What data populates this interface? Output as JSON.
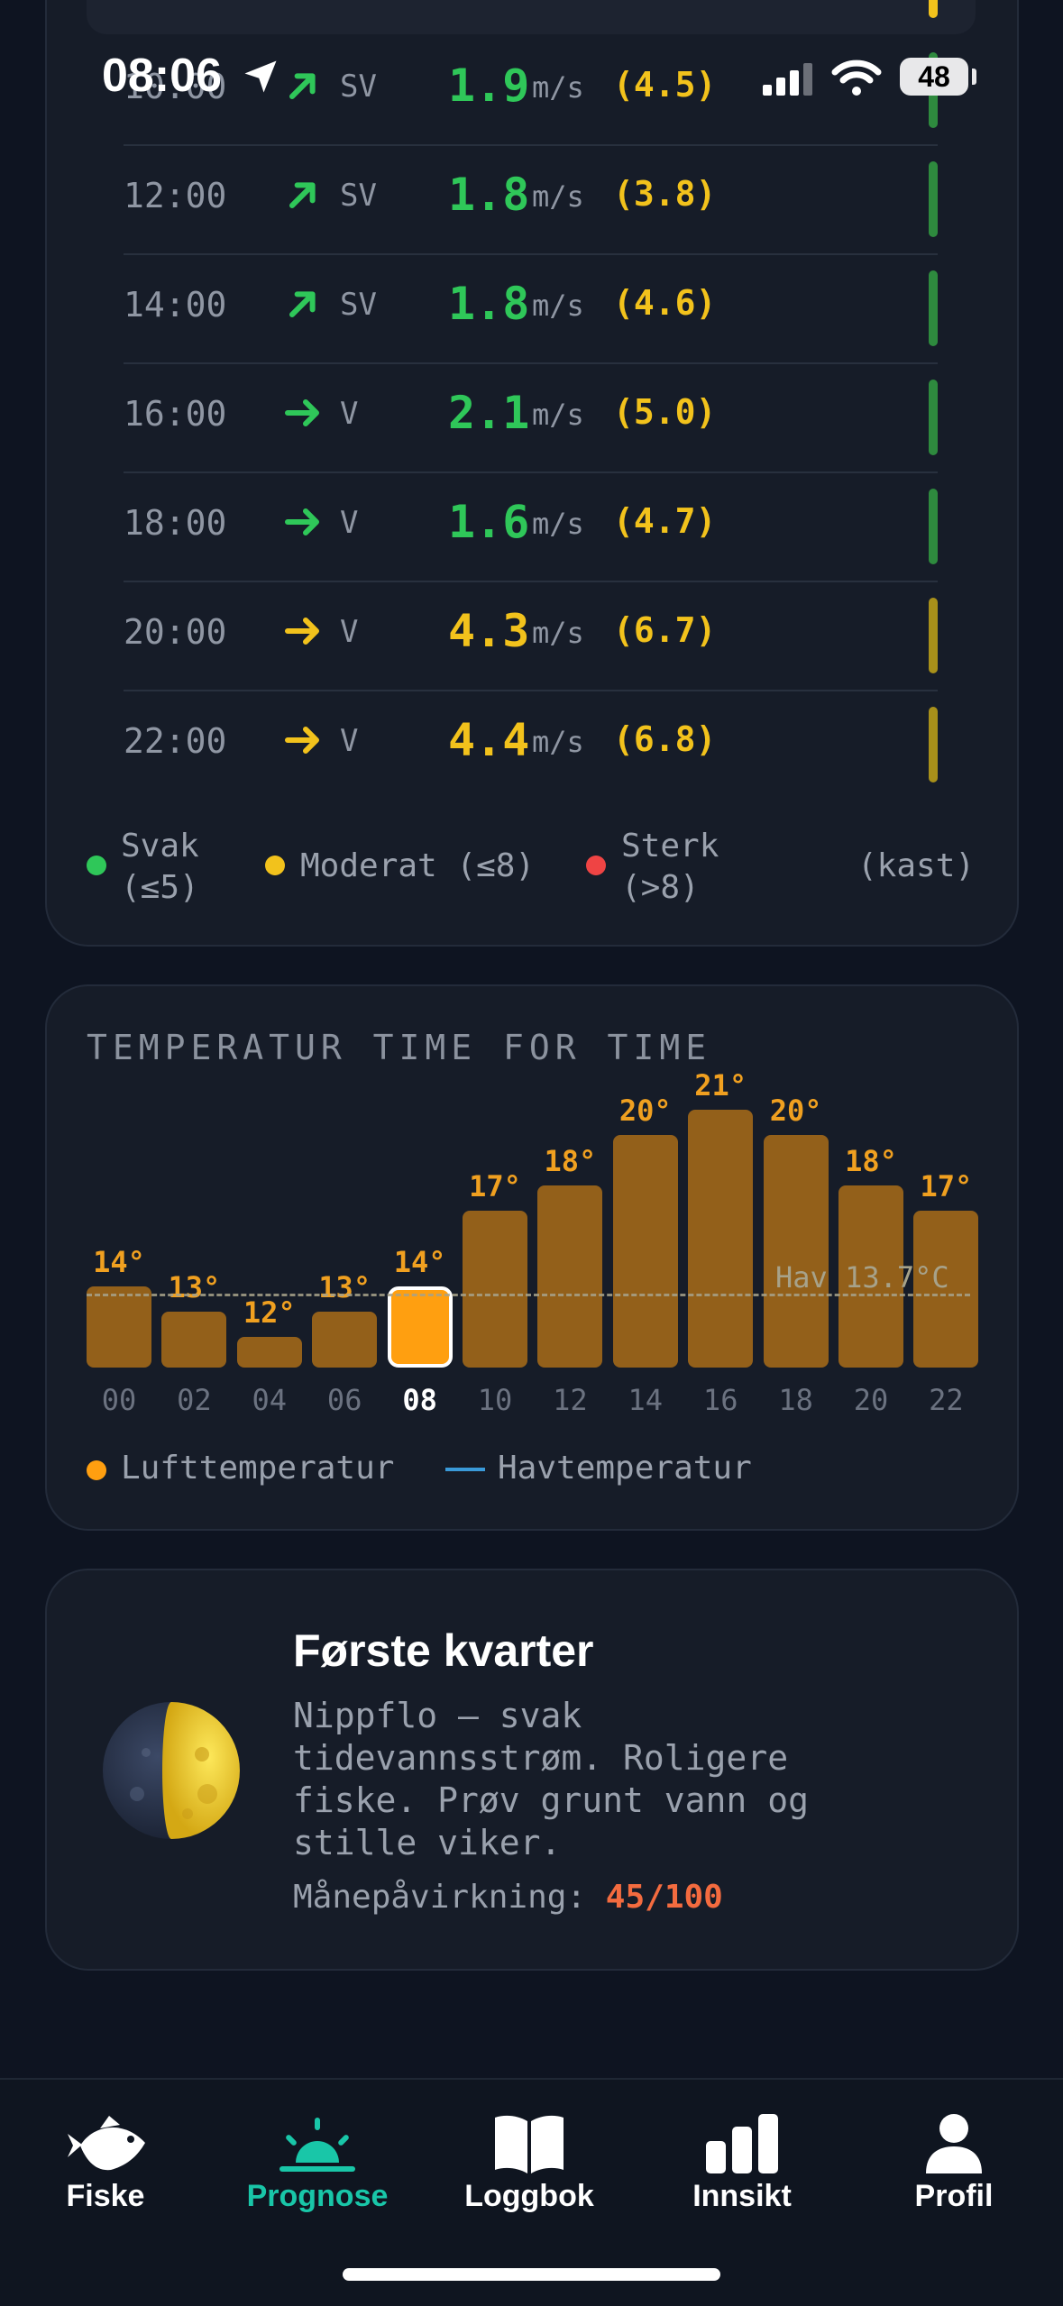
{
  "status_bar": {
    "time": "08:06",
    "battery": "48"
  },
  "wind": {
    "rows": [
      {
        "time": "10:00",
        "dir": "SV",
        "speed": "1.9",
        "unit": "m/s",
        "gust": "(4.5)",
        "level": "svak"
      },
      {
        "time": "12:00",
        "dir": "SV",
        "speed": "1.8",
        "unit": "m/s",
        "gust": "(3.8)",
        "level": "svak"
      },
      {
        "time": "14:00",
        "dir": "SV",
        "speed": "1.8",
        "unit": "m/s",
        "gust": "(4.6)",
        "level": "svak"
      },
      {
        "time": "16:00",
        "dir": "V",
        "speed": "2.1",
        "unit": "m/s",
        "gust": "(5.0)",
        "level": "svak"
      },
      {
        "time": "18:00",
        "dir": "V",
        "speed": "1.6",
        "unit": "m/s",
        "gust": "(4.7)",
        "level": "svak"
      },
      {
        "time": "20:00",
        "dir": "V",
        "speed": "4.3",
        "unit": "m/s",
        "gust": "(6.7)",
        "level": "moderat"
      },
      {
        "time": "22:00",
        "dir": "V",
        "speed": "4.4",
        "unit": "m/s",
        "gust": "(6.8)",
        "level": "moderat"
      }
    ],
    "legend": {
      "weak": "Svak",
      "weak_range": "(≤5)",
      "moderate": "Moderat (≤8)",
      "strong": "Sterk",
      "strong_range": "(>8)",
      "gust_note": "(kast)"
    },
    "colors": {
      "svak": "#2fc759",
      "moderat": "#f2c21c",
      "sterk": "#ef4444",
      "bar_svak": "#2e8a3e",
      "bar_moderat": "#a8901a"
    }
  },
  "temperature": {
    "title": "TEMPERATUR TIME FOR TIME",
    "sea_label": "Hav 13.7°C",
    "legend_air": "Lufttemperatur",
    "legend_sea": "Havtemperatur",
    "current_hour": "08"
  },
  "chart_data": {
    "type": "bar",
    "categories": [
      "00",
      "02",
      "04",
      "06",
      "08",
      "10",
      "12",
      "14",
      "16",
      "18",
      "20",
      "22"
    ],
    "series": [
      {
        "name": "Lufttemperatur",
        "values": [
          14,
          13,
          12,
          13,
          14,
          17,
          18,
          20,
          21,
          20,
          18,
          17
        ]
      }
    ],
    "value_labels": [
      "14°",
      "13°",
      "12°",
      "13°",
      "14°",
      "17°",
      "18°",
      "20°",
      "21°",
      "20°",
      "18°",
      "17°"
    ],
    "reference_line": {
      "name": "Havtemperatur",
      "value": 13.7
    },
    "highlight_index": 4,
    "colors": {
      "bar": "#93601a",
      "highlight": "#ff9f10",
      "sea": "#3a9ad9"
    }
  },
  "moon": {
    "phase": "Første kvarter",
    "description": "Nippflo — svak tidevannsstrøm. Roligere fiske. Prøv grunt vann og stille viker.",
    "influence_label": "Månepåvirkning:",
    "influence_value": "45/100"
  },
  "nav": {
    "items": [
      {
        "label": "Fiske",
        "icon": "fish-icon"
      },
      {
        "label": "Prognose",
        "icon": "sunrise-icon",
        "active": true
      },
      {
        "label": "Loggbok",
        "icon": "book-icon"
      },
      {
        "label": "Innsikt",
        "icon": "bar-chart-icon"
      },
      {
        "label": "Profil",
        "icon": "person-icon"
      }
    ],
    "active_color": "#19c6a8"
  }
}
